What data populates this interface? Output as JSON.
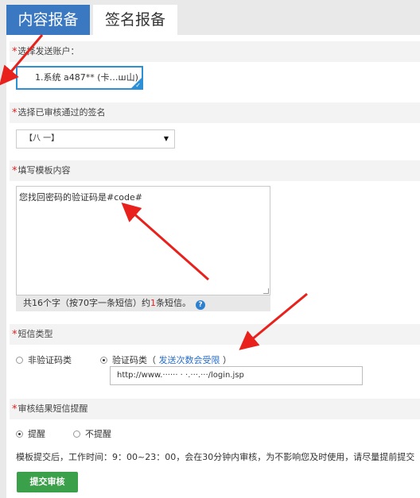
{
  "tabs": {
    "active": "内容报备",
    "inactive": "签名报备"
  },
  "account": {
    "label": "选择发送账户：",
    "value": "1.系统 a487** (卡…ш山)"
  },
  "signature": {
    "label": "选择已审核通过的签名",
    "value": "【八    一】"
  },
  "template": {
    "label": "填写模板内容",
    "content": "您找回密码的验证码是#code#",
    "counter_prefix": "共16个字（按70字一条短信）约",
    "counter_num": "1",
    "counter_suffix": "条短信。",
    "help_icon": "?"
  },
  "sms_type": {
    "label": "短信类型",
    "option_nonverify": "非验证码类",
    "option_verify": "验证码类（",
    "link": "发送次数会受限",
    "close_paren": "）",
    "url_value": "http://www.······    · ·.···.···/login.jsp",
    "selected": "验证码类"
  },
  "review_notice": {
    "label": "审核结果短信提醒",
    "option_remind": "提醒",
    "option_noremind": "不提醒",
    "selected": "提醒"
  },
  "note": "模板提交后，工作时间：9：00~23：00，会在30分钟内审核，为不影响您及时使用，请尽量提前提交",
  "submit_label": "提交审核",
  "required_mark": "*",
  "check_mark": "✓",
  "caret": "▼",
  "colors": {
    "tab_active": "#3b78c2",
    "accent_blue": "#2d8fd6",
    "required_red": "#e02020",
    "submit_green": "#3aa04a",
    "arrow_red": "#e8211c"
  }
}
